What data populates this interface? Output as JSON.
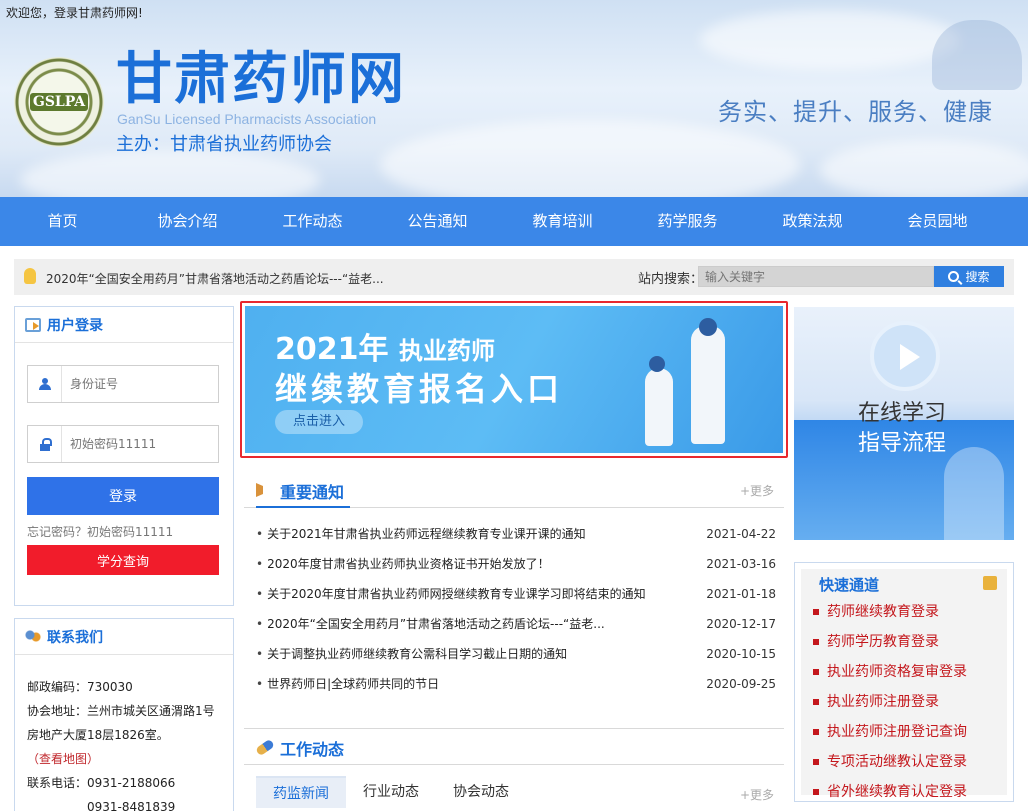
{
  "header": {
    "welcome": "欢迎您，登录甘肃药师网!",
    "seal_text": "GSLPA",
    "site_title": "甘肃药师网",
    "site_title_en": "GanSu Licensed Pharmacists Association",
    "sponsor": "主办：甘肃省执业药师协会",
    "slogan": "务实、提升、服务、健康"
  },
  "nav": [
    "首页",
    "协会介绍",
    "工作动态",
    "公告通知",
    "教育培训",
    "药学服务",
    "政策法规",
    "会员园地"
  ],
  "ticker": {
    "text": "2020年“全国安全用药月”甘肃省落地活动之药盾论坛---“益老...",
    "search_label": "站内搜索：",
    "search_placeholder": "输入关键字",
    "search_button": "搜索"
  },
  "login": {
    "title": "用户登录",
    "id_placeholder": "身份证号",
    "pwd_placeholder": "初始密码11111",
    "login_button": "登录",
    "forgot": "忘记密码？初始密码11111",
    "score_button": "学分查询"
  },
  "contact": {
    "title": "联系我们",
    "postcode": "邮政编码：730030",
    "address1": "协会地址：兰州市城关区通渭路1号",
    "address2": "房地产大厦18层1826室。",
    "map_link": "（查看地图）",
    "phone1": "联系电话：0931-2188066",
    "phone2": "0931-8481839"
  },
  "banner": {
    "year": "2021年",
    "line1": "执业药师",
    "line2": "继续教育报名入口",
    "button": "点击进入"
  },
  "notices": {
    "title": "重要通知",
    "more": "+更多",
    "items": [
      {
        "title": "关于2021年甘肃省执业药师远程继续教育专业课开课的通知",
        "date": "2021-04-22"
      },
      {
        "title": "2020年度甘肃省执业药师执业资格证书开始发放了！",
        "date": "2021-03-16"
      },
      {
        "title": "关于2020年度甘肃省执业药师网授继续教育专业课学习即将结束的通知",
        "date": "2021-01-18"
      },
      {
        "title": "2020年“全国安全用药月”甘肃省落地活动之药盾论坛---“益老...",
        "date": "2020-12-17"
      },
      {
        "title": "关于调整执业药师继续教育公需科目学习截止日期的通知",
        "date": "2020-10-15"
      },
      {
        "title": "世界药师日|全球药师共同的节日",
        "date": "2020-09-25"
      }
    ]
  },
  "work": {
    "title": "工作动态",
    "tabs": [
      "药监新闻",
      "行业动态",
      "协会动态"
    ],
    "more": "+更多"
  },
  "guide": {
    "line1": "在线学习",
    "line2": "指导流程"
  },
  "quick": {
    "title": "快速通道",
    "items": [
      "药师继续教育登录",
      "药师学历教育登录",
      "执业药师资格复审登录",
      "执业药师注册登录",
      "执业药师注册登记查询",
      "专项活动继教认定登录",
      "省外继续教育认定登录"
    ]
  }
}
